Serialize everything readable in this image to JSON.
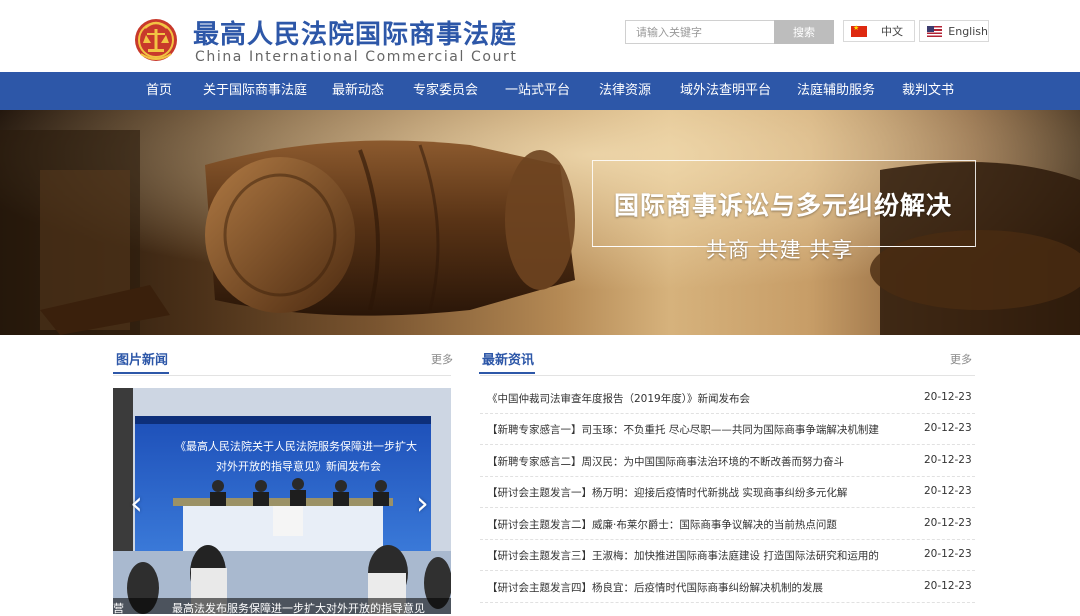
{
  "header": {
    "title_cn": "最高人民法院国际商事法庭",
    "title_en": "China International Commercial Court",
    "search_placeholder": "请输入关键字",
    "search_button": "搜索",
    "lang_cn": "中文",
    "lang_en": "English",
    "logo_icon": "court-emblem-icon"
  },
  "nav": {
    "items": [
      "首页",
      "关于国际商事法庭",
      "最新动态",
      "专家委员会",
      "一站式平台",
      "法律资源",
      "域外法查明平台",
      "法庭辅助服务",
      "裁判文书"
    ]
  },
  "banner": {
    "title": "国际商事诉讼与多元纠纷解决",
    "subtitle": "共商 共建 共享"
  },
  "photo_news": {
    "heading": "图片新闻",
    "more": "更多",
    "screen_line1": "《最高人民法院关于人民法院服务保障进一步扩大",
    "screen_line2": "对外开放的指导意见》新闻发布会",
    "caption": "最高法发布服务保障进一步扩大对外开放的指导意见",
    "caption_left": "营",
    "prev_icon": "chevron-left-icon",
    "next_icon": "chevron-right-icon"
  },
  "latest_news": {
    "heading": "最新资讯",
    "more": "更多",
    "items": [
      {
        "title": "《中国仲裁司法审查年度报告（2019年度）》新闻发布会",
        "date": "20-12-23"
      },
      {
        "title": "【新聘专家感言一】司玉琢：不负重托 尽心尽职——共同为国际商事争端解决机制建",
        "date": "20-12-23"
      },
      {
        "title": "【新聘专家感言二】周汉民：为中国国际商事法治环境的不断改善而努力奋斗",
        "date": "20-12-23"
      },
      {
        "title": "【研讨会主题发言一】杨万明：迎接后疫情时代新挑战 实现商事纠纷多元化解",
        "date": "20-12-23"
      },
      {
        "title": "【研讨会主题发言二】威廉·布莱尔爵士：国际商事争议解决的当前热点问题",
        "date": "20-12-23"
      },
      {
        "title": "【研讨会主题发言三】王淑梅：加快推进国际商事法庭建设 打造国际法研究和运用的",
        "date": "20-12-23"
      },
      {
        "title": "【研讨会主题发言四】杨良宜：后疫情时代国际商事纠纷解决机制的发展",
        "date": "20-12-23"
      }
    ]
  },
  "colors": {
    "brand_blue": "#2d57a8",
    "nav_bg": "#2d57a8",
    "search_button_bg": "#bdbdbd"
  }
}
